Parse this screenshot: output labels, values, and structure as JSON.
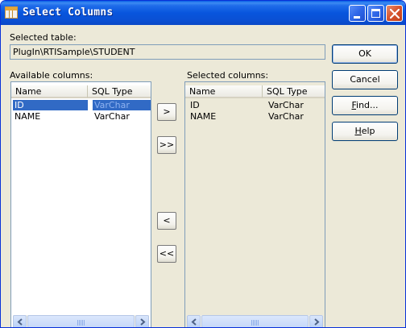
{
  "window": {
    "title": "Select Columns"
  },
  "selected_table": {
    "label": "Selected table:",
    "value": "PlugIn\\RTISample\\STUDENT"
  },
  "available": {
    "label": "Available columns:",
    "columns": [
      "Name",
      "SQL Type"
    ],
    "rows": [
      {
        "name": "ID",
        "sql_type": "VarChar",
        "selected": true
      },
      {
        "name": "NAME",
        "sql_type": "VarChar",
        "selected": false
      }
    ]
  },
  "selected": {
    "label": "Selected columns:",
    "columns": [
      "Name",
      "SQL Type"
    ],
    "rows": [
      {
        "name": "ID",
        "sql_type": "VarChar"
      },
      {
        "name": "NAME",
        "sql_type": "VarChar"
      }
    ]
  },
  "transfer_buttons": {
    "add_one": ">",
    "add_all": ">>",
    "remove_one": "<",
    "remove_all": "<<"
  },
  "actions": {
    "ok": "OK",
    "cancel": "Cancel",
    "find_prefix": "F",
    "find_rest": "ind...",
    "help_prefix": "H",
    "help_rest": "elp"
  },
  "colors": {
    "title_bar": "#0855dd",
    "dialog_face": "#ece9d8",
    "selection": "#316ac5"
  }
}
